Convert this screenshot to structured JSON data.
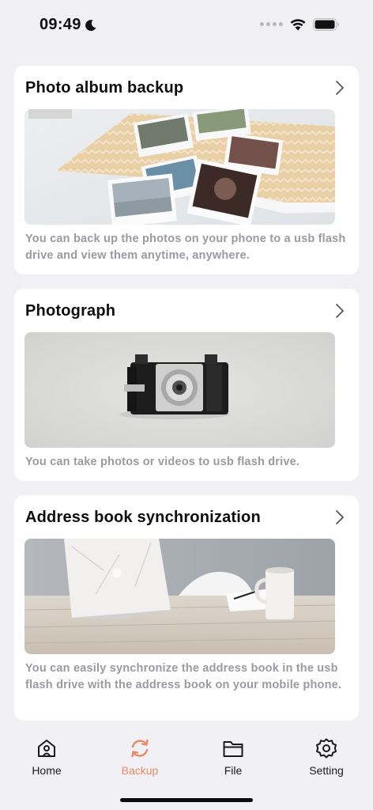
{
  "status_bar": {
    "time": "09:49"
  },
  "cards": [
    {
      "title": "Photo album backup",
      "description": "You can back up the photos on your phone to a usb flash drive and view them anytime, anywhere.",
      "image": "photo-album-image"
    },
    {
      "title": "Photograph",
      "description": "You can take photos or videos to usb flash drive.",
      "image": "vintage-camera-image"
    },
    {
      "title": "Address book synchronization",
      "description": "You can easily synchronize the address book in the usb flash drive with the address book on your mobile phone.",
      "image": "laptop-desk-image"
    }
  ],
  "tabs": [
    {
      "label": "Home",
      "icon": "home-icon",
      "active": false
    },
    {
      "label": "Backup",
      "icon": "sync-icon",
      "active": true
    },
    {
      "label": "File",
      "icon": "folder-icon",
      "active": false
    },
    {
      "label": "Setting",
      "icon": "gear-icon",
      "active": false
    }
  ],
  "colors": {
    "accent": "#e98a66",
    "background": "#f1f0f5",
    "card": "#ffffff",
    "muted_text": "#9a9aa0"
  }
}
